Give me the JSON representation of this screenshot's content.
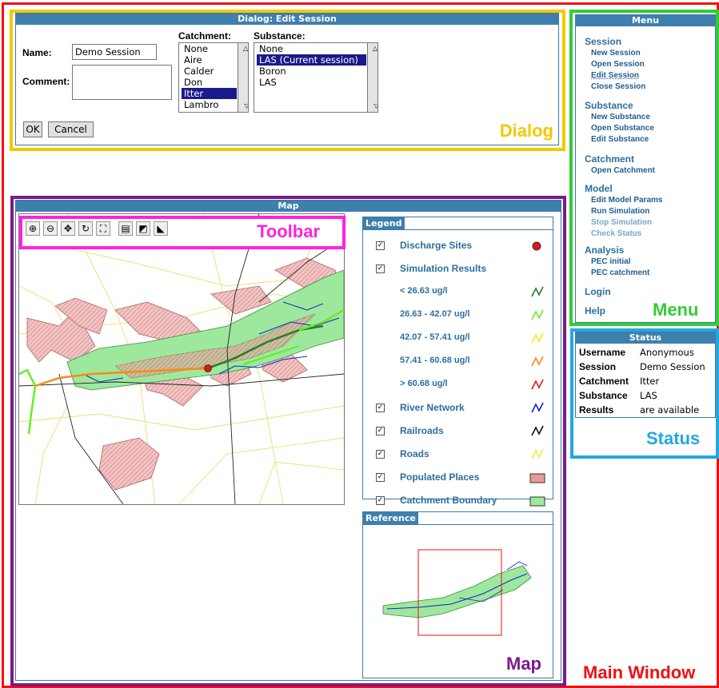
{
  "dialog": {
    "title": "Dialog: Edit Session",
    "name_label": "Name:",
    "name_value": "Demo Session",
    "comment_label": "Comment:",
    "comment_value": "",
    "catchment_label": "Catchment:",
    "catchment_options": [
      "None",
      "Aire",
      "Calder",
      "Don",
      "Itter",
      "Lambro"
    ],
    "catchment_selected": "Itter",
    "substance_label": "Substance:",
    "substance_options": [
      "None",
      "LAS (Current session)",
      "Boron",
      "LAS"
    ],
    "substance_selected": "LAS (Current session)",
    "ok_label": "OK",
    "cancel_label": "Cancel"
  },
  "menu": {
    "title": "Menu",
    "sections": [
      {
        "heading": "Session",
        "items": [
          {
            "label": "New Session",
            "state": "normal"
          },
          {
            "label": "Open Session",
            "state": "normal"
          },
          {
            "label": "Edit Session",
            "state": "current"
          },
          {
            "label": "Close Session",
            "state": "normal"
          }
        ]
      },
      {
        "heading": "Substance",
        "items": [
          {
            "label": "New Substance",
            "state": "normal"
          },
          {
            "label": "Open Substance",
            "state": "normal"
          },
          {
            "label": "Edit Substance",
            "state": "normal"
          }
        ]
      },
      {
        "heading": "Catchment",
        "items": [
          {
            "label": "Open Catchment",
            "state": "normal"
          }
        ]
      },
      {
        "heading": "Model",
        "items": [
          {
            "label": "Edit Model Params",
            "state": "normal"
          },
          {
            "label": "Run Simulation",
            "state": "normal"
          },
          {
            "label": "Stop Simulation",
            "state": "disabled"
          },
          {
            "label": "Check Status",
            "state": "disabled"
          }
        ]
      },
      {
        "heading": "Analysis",
        "items": [
          {
            "label": "PEC initial",
            "state": "normal"
          },
          {
            "label": "PEC catchment",
            "state": "normal"
          }
        ]
      },
      {
        "heading": "Login",
        "items": []
      },
      {
        "heading": "Help",
        "items": []
      }
    ]
  },
  "status": {
    "title": "Status",
    "rows": [
      {
        "key": "Username",
        "value": "Anonymous"
      },
      {
        "key": "Session",
        "value": "Demo Session"
      },
      {
        "key": "Catchment",
        "value": "Itter"
      },
      {
        "key": "Substance",
        "value": "LAS"
      },
      {
        "key": "Results",
        "value": "are available"
      }
    ]
  },
  "map": {
    "title": "Map",
    "toolbar_icons": [
      "zoom-in-icon",
      "zoom-out-icon",
      "pan-icon",
      "refresh-icon",
      "full-extent-icon",
      "layer-info-icon",
      "identify-icon",
      "measure-icon"
    ],
    "legend_tab": "Legend",
    "legend": [
      {
        "label": "Discharge Sites",
        "checkbox": true,
        "symbol": "dot",
        "color": "#ee1111"
      },
      {
        "label": "Simulation Results",
        "checkbox": true,
        "symbol": "none",
        "color": ""
      },
      {
        "label": "< 26.63 ug/l",
        "checkbox": false,
        "symbol": "line",
        "color": "#2a7a2a"
      },
      {
        "label": "26.63 - 42.07 ug/l",
        "checkbox": false,
        "symbol": "line",
        "color": "#66ee22"
      },
      {
        "label": "42.07 - 57.41 ug/l",
        "checkbox": false,
        "symbol": "line",
        "color": "#eeee22"
      },
      {
        "label": "57.41 - 60.68 ug/l",
        "checkbox": false,
        "symbol": "line",
        "color": "#ff8811"
      },
      {
        "label": "> 60.68 ug/l",
        "checkbox": false,
        "symbol": "line",
        "color": "#ee1111"
      },
      {
        "label": "River Network",
        "checkbox": true,
        "symbol": "line",
        "color": "#1122cc"
      },
      {
        "label": "Railroads",
        "checkbox": true,
        "symbol": "line",
        "color": "#111111"
      },
      {
        "label": "Roads",
        "checkbox": true,
        "symbol": "line",
        "color": "#eeee44"
      },
      {
        "label": "Populated Places",
        "checkbox": true,
        "symbol": "rect",
        "color": "#e99a9a"
      },
      {
        "label": "Catchment Boundary",
        "checkbox": true,
        "symbol": "rect",
        "color": "#9ee89e"
      }
    ],
    "reference_tab": "Reference"
  },
  "annotations": {
    "dialog": "Dialog",
    "toolbar": "Toolbar",
    "menu": "Menu",
    "status": "Status",
    "map": "Map",
    "main_window": "Main Window"
  },
  "colors": {
    "main_window": "#ee1111",
    "dialog": "#f5c800",
    "menu": "#33cc33",
    "status": "#22a8e0",
    "map": "#7a1a8a",
    "toolbar": "#ff22dd",
    "panel_title": "#3f7fae"
  }
}
